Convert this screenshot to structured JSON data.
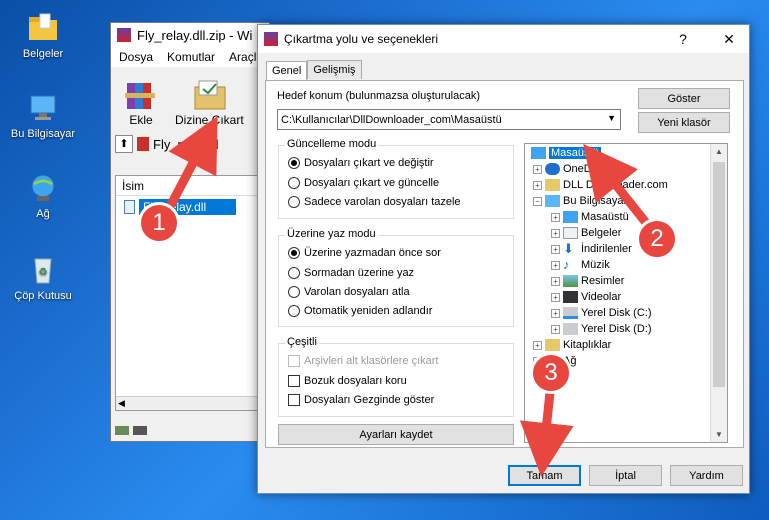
{
  "desktop": {
    "icons": [
      {
        "label": "Belgeler",
        "icon": "folder-icon"
      },
      {
        "label": "Bu Bilgisayar",
        "icon": "computer-icon"
      },
      {
        "label": "Ağ",
        "icon": "network-icon"
      },
      {
        "label": "Çöp Kutusu",
        "icon": "recycle-bin-icon"
      }
    ]
  },
  "winrar": {
    "title": "Fly_relay.dll.zip - Wi",
    "menu": [
      "Dosya",
      "Komutlar",
      "Araçla"
    ],
    "toolbar": {
      "add_label": "Ekle",
      "extract_label": "Dizine Çıkart"
    },
    "path": "Fly_relay.dl",
    "column_name": "İsim",
    "file": "Fly_relay.dll"
  },
  "dialog": {
    "title": "Çıkartma yolu ve seçenekleri",
    "help_btn": "?",
    "close_btn": "✕",
    "tabs": [
      "Genel",
      "Gelişmiş"
    ],
    "dest_label": "Hedef konum (bulunmazsa oluşturulacak)",
    "dest_value": "C:\\Kullanıcılar\\DllDownloader_com\\Masaüstü",
    "show_btn": "Göster",
    "new_folder_btn": "Yeni klasör",
    "update_mode": {
      "title": "Güncelleme modu",
      "options": [
        "Dosyaları çıkart ve değiştir",
        "Dosyaları çıkart ve güncelle",
        "Sadece varolan dosyaları tazele"
      ],
      "selected": 0
    },
    "overwrite_mode": {
      "title": "Üzerine yaz modu",
      "options": [
        "Üzerine yazmadan önce sor",
        "Sormadan üzerine yaz",
        "Varolan dosyaları atla",
        "Otomatik yeniden adlandır"
      ],
      "selected": 0
    },
    "misc": {
      "title": "Çeşitli",
      "options": [
        "Arşivleri alt klasörlere çıkart",
        "Bozuk dosyaları koru",
        "Dosyaları Gezginde göster"
      ]
    },
    "save_settings_btn": "Ayarları kaydet",
    "tree": [
      {
        "label": "Masaüstü",
        "selected": true
      },
      {
        "label": "OneDrive"
      },
      {
        "label": "DLL Downloader.com"
      },
      {
        "label": "Bu Bilgisayar"
      },
      {
        "label": "Masaüstü"
      },
      {
        "label": "Belgeler"
      },
      {
        "label": "İndirilenler"
      },
      {
        "label": "Müzik"
      },
      {
        "label": "Resimler"
      },
      {
        "label": "Videolar"
      },
      {
        "label": "Yerel Disk (C:)"
      },
      {
        "label": "Yerel Disk (D:)"
      },
      {
        "label": "Kitaplıklar"
      },
      {
        "label": "Ağ"
      }
    ],
    "ok_btn": "Tamam",
    "cancel_btn": "İptal",
    "help_btn2": "Yardım"
  },
  "annotations": [
    "1",
    "2",
    "3"
  ],
  "colors": {
    "accent": "#0078d7",
    "badge": "#e8473f",
    "desktop": "#1f74d6"
  }
}
